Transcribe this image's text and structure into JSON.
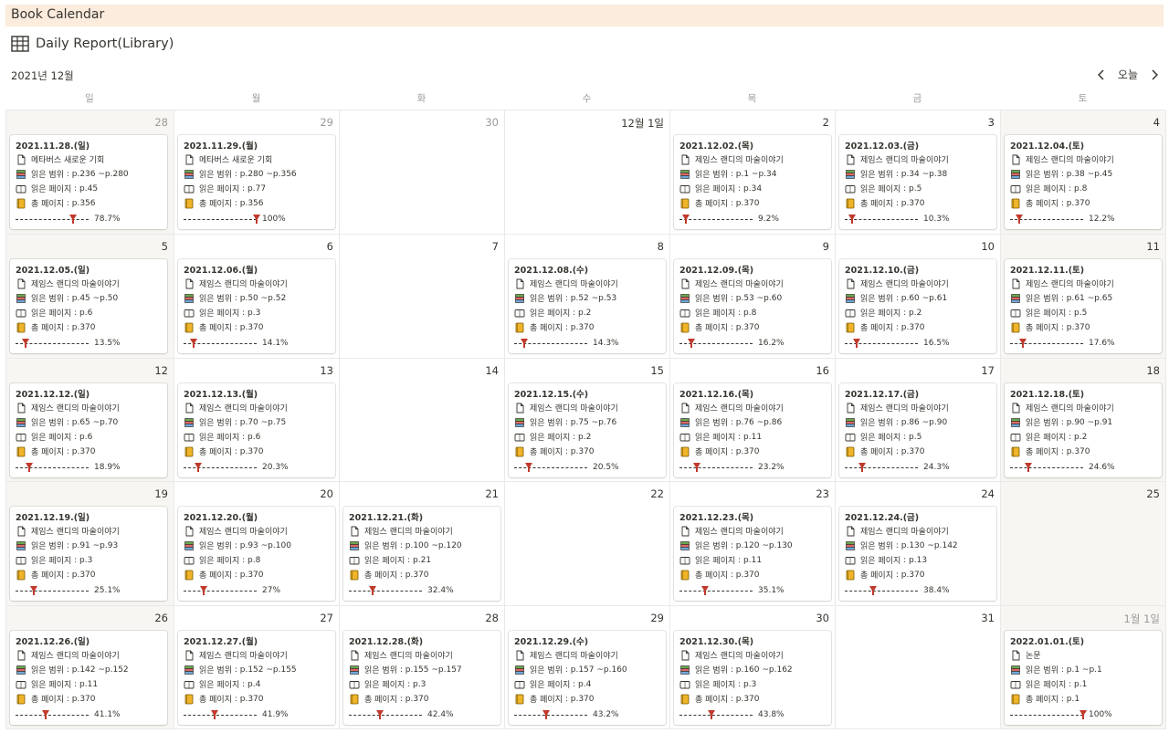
{
  "app": {
    "title": "Book Calendar"
  },
  "view": {
    "title": "Daily Report(Library)",
    "icon": "table-grid-icon"
  },
  "calendar": {
    "month_label": "2021년 12월",
    "today_label": "오늘",
    "weekdays": [
      "일",
      "월",
      "화",
      "수",
      "목",
      "금",
      "토"
    ],
    "labels": {
      "range": "읽은 범위",
      "pages": "읽은 페이지",
      "total": "총 페이지"
    },
    "colors": {
      "header_bg": "#fbecdd",
      "weekend_bg": "#f7f6f3",
      "pin": "#c0392b",
      "tab": "#f0b429"
    },
    "days": [
      {
        "label": "28",
        "muted": true
      },
      {
        "label": "29",
        "muted": true
      },
      {
        "label": "30",
        "muted": true
      },
      {
        "label": "12월 1일"
      },
      {
        "label": "2"
      },
      {
        "label": "3"
      },
      {
        "label": "4"
      },
      {
        "label": "5"
      },
      {
        "label": "6"
      },
      {
        "label": "7"
      },
      {
        "label": "8"
      },
      {
        "label": "9"
      },
      {
        "label": "10"
      },
      {
        "label": "11"
      },
      {
        "label": "12"
      },
      {
        "label": "13"
      },
      {
        "label": "14"
      },
      {
        "label": "15"
      },
      {
        "label": "16"
      },
      {
        "label": "17"
      },
      {
        "label": "18"
      },
      {
        "label": "19"
      },
      {
        "label": "20"
      },
      {
        "label": "21"
      },
      {
        "label": "22"
      },
      {
        "label": "23"
      },
      {
        "label": "24"
      },
      {
        "label": "25"
      },
      {
        "label": "26"
      },
      {
        "label": "27"
      },
      {
        "label": "28"
      },
      {
        "label": "29"
      },
      {
        "label": "30"
      },
      {
        "label": "31"
      },
      {
        "label": "1월 1일",
        "muted": true
      }
    ],
    "entries": [
      {
        "cell": 0,
        "title": "2021.11.28.(일)",
        "book": "메타버스 새로운 기회",
        "range": "p.236 ~p.280",
        "pages": "p.45",
        "total": "p.356",
        "progress": 78.7,
        "progress_label": "78.7%"
      },
      {
        "cell": 1,
        "title": "2021.11.29.(월)",
        "book": "메타버스 새로운 기회",
        "range": "p.280 ~p.356",
        "pages": "p.77",
        "total": "p.356",
        "progress": 100,
        "progress_label": "100%"
      },
      {
        "cell": 4,
        "title": "2021.12.02.(목)",
        "book": "제임스 랜디의 마술이야기",
        "range": "p.1 ~p.34",
        "pages": "p.34",
        "total": "p.370",
        "progress": 9.2,
        "progress_label": "9.2%"
      },
      {
        "cell": 5,
        "title": "2021.12.03.(금)",
        "book": "제임스 랜디의 마술이야기",
        "range": "p.34 ~p.38",
        "pages": "p.5",
        "total": "p.370",
        "progress": 10.3,
        "progress_label": "10.3%"
      },
      {
        "cell": 6,
        "title": "2021.12.04.(토)",
        "book": "제임스 랜디의 마술이야기",
        "range": "p.38 ~p.45",
        "pages": "p.8",
        "total": "p.370",
        "progress": 12.2,
        "progress_label": "12.2%"
      },
      {
        "cell": 7,
        "title": "2021.12.05.(일)",
        "book": "제임스 랜디의 마술이야기",
        "range": "p.45 ~p.50",
        "pages": "p.6",
        "total": "p.370",
        "progress": 13.5,
        "progress_label": "13.5%"
      },
      {
        "cell": 8,
        "title": "2021.12.06.(월)",
        "book": "제임스 랜디의 마술이야기",
        "range": "p.50 ~p.52",
        "pages": "p.3",
        "total": "p.370",
        "progress": 14.1,
        "progress_label": "14.1%"
      },
      {
        "cell": 10,
        "title": "2021.12.08.(수)",
        "book": "제임스 랜디의 마술이야기",
        "range": "p.52 ~p.53",
        "pages": "p.2",
        "total": "p.370",
        "progress": 14.3,
        "progress_label": "14.3%"
      },
      {
        "cell": 11,
        "title": "2021.12.09.(목)",
        "book": "제임스 랜디의 마술이야기",
        "range": "p.53 ~p.60",
        "pages": "p.8",
        "total": "p.370",
        "progress": 16.2,
        "progress_label": "16.2%"
      },
      {
        "cell": 12,
        "title": "2021.12.10.(금)",
        "book": "제임스 랜디의 마술이야기",
        "range": "p.60 ~p.61",
        "pages": "p.2",
        "total": "p.370",
        "progress": 16.5,
        "progress_label": "16.5%"
      },
      {
        "cell": 13,
        "title": "2021.12.11.(토)",
        "book": "제임스 랜디의 마술이야기",
        "range": "p.61 ~p.65",
        "pages": "p.5",
        "total": "p.370",
        "progress": 17.6,
        "progress_label": "17.6%"
      },
      {
        "cell": 14,
        "title": "2021.12.12.(일)",
        "book": "제임스 랜디의 마술이야기",
        "range": "p.65 ~p.70",
        "pages": "p.6",
        "total": "p.370",
        "progress": 18.9,
        "progress_label": "18.9%"
      },
      {
        "cell": 15,
        "title": "2021.12.13.(월)",
        "book": "제임스 랜디의 마술이야기",
        "range": "p.70 ~p.75",
        "pages": "p.6",
        "total": "p.370",
        "progress": 20.3,
        "progress_label": "20.3%"
      },
      {
        "cell": 17,
        "title": "2021.12.15.(수)",
        "book": "제임스 랜디의 마술이야기",
        "range": "p.75 ~p.76",
        "pages": "p.2",
        "total": "p.370",
        "progress": 20.5,
        "progress_label": "20.5%"
      },
      {
        "cell": 18,
        "title": "2021.12.16.(목)",
        "book": "제임스 랜디의 마술이야기",
        "range": "p.76 ~p.86",
        "pages": "p.11",
        "total": "p.370",
        "progress": 23.2,
        "progress_label": "23.2%"
      },
      {
        "cell": 19,
        "title": "2021.12.17.(금)",
        "book": "제임스 랜디의 마술이야기",
        "range": "p.86 ~p.90",
        "pages": "p.5",
        "total": "p.370",
        "progress": 24.3,
        "progress_label": "24.3%"
      },
      {
        "cell": 20,
        "title": "2021.12.18.(토)",
        "book": "제임스 랜디의 마술이야기",
        "range": "p.90 ~p.91",
        "pages": "p.2",
        "total": "p.370",
        "progress": 24.6,
        "progress_label": "24.6%"
      },
      {
        "cell": 21,
        "title": "2021.12.19.(일)",
        "book": "제임스 랜디의 마술이야기",
        "range": "p.91 ~p.93",
        "pages": "p.3",
        "total": "p.370",
        "progress": 25.1,
        "progress_label": "25.1%"
      },
      {
        "cell": 22,
        "title": "2021.12.20.(월)",
        "book": "제임스 랜디의 마술이야기",
        "range": "p.93 ~p.100",
        "pages": "p.8",
        "total": "p.370",
        "progress": 27,
        "progress_label": "27%"
      },
      {
        "cell": 23,
        "title": "2021.12.21.(화)",
        "book": "제임스 랜디의 마술이야기",
        "range": "p.100 ~p.120",
        "pages": "p.21",
        "total": "p.370",
        "progress": 32.4,
        "progress_label": "32.4%"
      },
      {
        "cell": 25,
        "title": "2021.12.23.(목)",
        "book": "제임스 랜디의 마술이야기",
        "range": "p.120 ~p.130",
        "pages": "p.11",
        "total": "p.370",
        "progress": 35.1,
        "progress_label": "35.1%"
      },
      {
        "cell": 26,
        "title": "2021.12.24.(금)",
        "book": "제임스 랜디의 마술이야기",
        "range": "p.130 ~p.142",
        "pages": "p.13",
        "total": "p.370",
        "progress": 38.4,
        "progress_label": "38.4%"
      },
      {
        "cell": 28,
        "title": "2021.12.26.(일)",
        "book": "제임스 랜디의 마술이야기",
        "range": "p.142 ~p.152",
        "pages": "p.11",
        "total": "p.370",
        "progress": 41.1,
        "progress_label": "41.1%"
      },
      {
        "cell": 29,
        "title": "2021.12.27.(월)",
        "book": "제임스 랜디의 마술이야기",
        "range": "p.152 ~p.155",
        "pages": "p.4",
        "total": "p.370",
        "progress": 41.9,
        "progress_label": "41.9%"
      },
      {
        "cell": 30,
        "title": "2021.12.28.(화)",
        "book": "제임스 랜디의 마술이야기",
        "range": "p.155 ~p.157",
        "pages": "p.3",
        "total": "p.370",
        "progress": 42.4,
        "progress_label": "42.4%"
      },
      {
        "cell": 31,
        "title": "2021.12.29.(수)",
        "book": "제임스 랜디의 마술이야기",
        "range": "p.157 ~p.160",
        "pages": "p.4",
        "total": "p.370",
        "progress": 43.2,
        "progress_label": "43.2%"
      },
      {
        "cell": 32,
        "title": "2021.12.30.(목)",
        "book": "제임스 랜디의 마술이야기",
        "range": "p.160 ~p.162",
        "pages": "p.3",
        "total": "p.370",
        "progress": 43.8,
        "progress_label": "43.8%"
      },
      {
        "cell": 34,
        "title": "2022.01.01.(토)",
        "book": "논문",
        "range": "p.1 ~p.1",
        "pages": "p.1",
        "total": "p.1",
        "progress": 100,
        "progress_label": "100%"
      }
    ]
  }
}
